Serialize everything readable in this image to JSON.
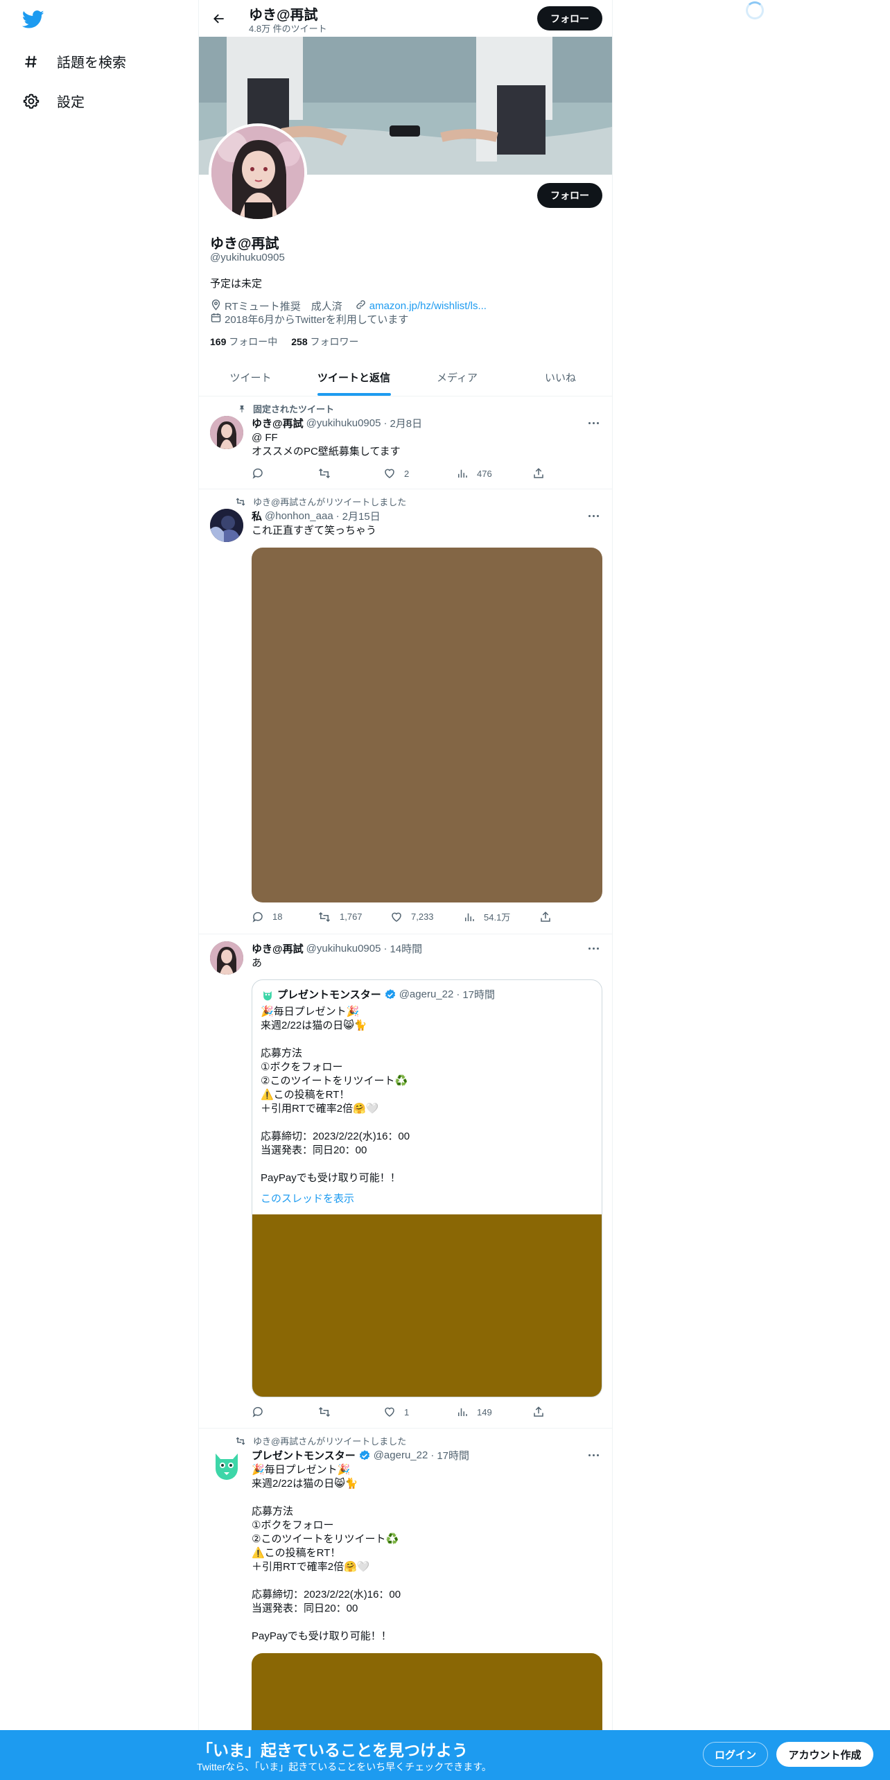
{
  "sidebar": {
    "items": [
      {
        "label": "話題を検索",
        "icon": "hashtag-icon"
      },
      {
        "label": "設定",
        "icon": "gear-icon"
      }
    ]
  },
  "header": {
    "name": "ゆき@再試",
    "tweet_count": "4.8万 件のツイート",
    "follow_label": "フォロー"
  },
  "profile": {
    "name": "ゆき@再試",
    "handle": "@yukihuku0905",
    "bio": "予定は未定",
    "location": "RTミュート推奨　成人済",
    "link": "amazon.jp/hz/wishlist/ls...",
    "joined": "2018年6月からTwitterを利用しています",
    "following_count": "169",
    "following_label": "フォロー中",
    "followers_count": "258",
    "followers_label": "フォロワー",
    "follow_label": "フォロー"
  },
  "tabs": [
    {
      "label": "ツイート",
      "active": false
    },
    {
      "label": "ツイートと返信",
      "active": true
    },
    {
      "label": "メディア",
      "active": false
    },
    {
      "label": "いいね",
      "active": false
    }
  ],
  "tweets": [
    {
      "social": "固定されたツイート",
      "name": "ゆき@再試",
      "handle": "@yukihuku0905",
      "date": "2月8日",
      "text": "@ FF\nオススメのPC壁紙募集してます",
      "reply": "",
      "retweet": "",
      "like": "2",
      "views": "476"
    },
    {
      "social": "ゆき@再試さんがリツイートしました",
      "name": "私",
      "handle": "@honhon_aaa",
      "date": "2月15日",
      "text": "これ正直すぎて笑っちゃう",
      "media_color": "#836645",
      "reply": "18",
      "retweet": "1,767",
      "like": "7,233",
      "views": "54.1万"
    },
    {
      "name": "ゆき@再試",
      "handle": "@yukihuku0905",
      "date": "14時間",
      "text": "あ",
      "quote": {
        "name": "プレゼントモンスター",
        "handle": "@ageru_22",
        "date": "17時間",
        "text": "🎉毎日プレゼント🎉\n来週2/22は猫の日😸🐈\n\n応募方法\n①ボクをフォロー\n②このツイートをリツイート♻️\n⚠️この投稿をRT！\n＋引用RTで確率2倍🤗🤍\n\n応募締切：2023/2/22(水)16：00\n当選発表：同日20：00\n\nPayPayでも受け取り可能！！",
        "thread_link": "このスレッドを表示",
        "media_color": "#8a6705"
      },
      "reply": "",
      "retweet": "",
      "like": "1",
      "views": "149"
    },
    {
      "social": "ゆき@再試さんがリツイートしました",
      "name": "プレゼントモンスター",
      "handle": "@ageru_22",
      "date": "17時間",
      "text": "🎉毎日プレゼント🎉\n来週2/22は猫の日😸🐈\n\n応募方法\n①ボクをフォロー\n②このツイートをリツイート♻️\n⚠️この投稿をRT！\n＋引用RTで確率2倍🤗🤍\n\n応募締切：2023/2/22(水)16：00\n当選発表：同日20：00\n\nPayPayでも受け取り可能！！",
      "media_color": "#8a6705"
    }
  ],
  "bottom_bar": {
    "title": "「いま」起きていることを見つけよう",
    "subtitle": "Twitterなら、「いま」起きていることをいち早くチェックできます。",
    "login": "ログイン",
    "signup": "アカウント作成"
  },
  "colors": {
    "accent": "#1d9bf0",
    "text": "#0f1419",
    "secondary": "#536471",
    "verified": "#1d9bf0"
  }
}
